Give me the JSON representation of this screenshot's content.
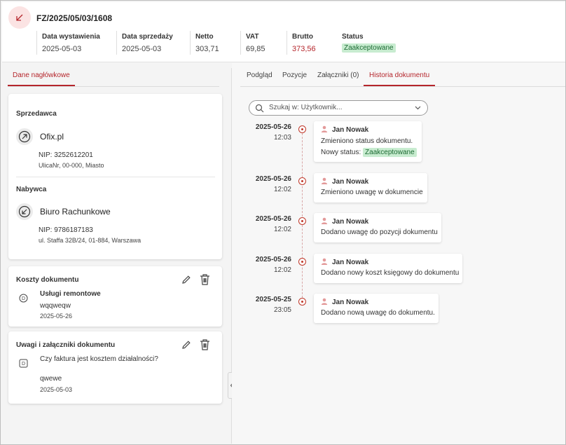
{
  "header": {
    "doc_number": "FZ/2025/05/03/1608",
    "fields": [
      {
        "label": "Data wystawienia",
        "value": "2025-05-03"
      },
      {
        "label": "Data sprzedaży",
        "value": "2025-05-03"
      },
      {
        "label": "Netto",
        "value": "303,71"
      },
      {
        "label": "VAT",
        "value": "69,85"
      },
      {
        "label": "Brutto",
        "value": "373,56"
      },
      {
        "label": "Status",
        "value": "Zaakceptowane"
      }
    ],
    "icon": "arrow-down-left-icon",
    "colors": {
      "accent": "#b5262c",
      "status_bg": "#c8ecd0",
      "status_fg": "#1d6b34"
    }
  },
  "left_tabs": [
    "Dane nagłówkowe"
  ],
  "parties": {
    "seller": {
      "title": "Sprzedawca",
      "name": "Ofix.pl",
      "nip": "NIP: 3252612201",
      "address": "UlicaNr, 00-000, Miasto",
      "icon": "arrow-up-right-circle-icon"
    },
    "buyer": {
      "title": "Nabywca",
      "name": "Biuro Rachunkowe",
      "nip": "NIP: 9786187183",
      "address": "ul. Staffa 32B/24, 01-884, Warszawa",
      "icon": "arrow-down-left-circle-icon"
    }
  },
  "costs": {
    "title": "Koszty dokumentu",
    "item_name": "Usługi remontowe",
    "item_desc": "wqqweqw",
    "item_date": "2025-05-26",
    "item_icon": "d-circle-icon"
  },
  "notes": {
    "title": "Uwagi i załączniki dokumentu",
    "question": "Czy faktura jest kosztem działalności?",
    "answer": "qwewe",
    "date": "2025-05-03",
    "item_icon": "d-square-icon"
  },
  "right_tabs": [
    "Podgląd",
    "Pozycje",
    "Załączniki (0)",
    "Historia dokumentu"
  ],
  "search": {
    "placeholder": "Szukaj w: Użytkownik..."
  },
  "history": [
    {
      "date": "2025-05-26",
      "time": "12:03",
      "user": "Jan Nowak",
      "text": "Zmieniono status dokumentu.",
      "status_prefix": "Nowy status:",
      "status": "Zaakceptowane"
    },
    {
      "date": "2025-05-26",
      "time": "12:02",
      "user": "Jan Nowak",
      "text": "Zmieniono uwagę w dokumencie"
    },
    {
      "date": "2025-05-26",
      "time": "12:02",
      "user": "Jan Nowak",
      "text": "Dodano uwagę do pozycji dokumentu"
    },
    {
      "date": "2025-05-26",
      "time": "12:02",
      "user": "Jan Nowak",
      "text": "Dodano nowy koszt księgowy do dokumentu"
    },
    {
      "date": "2025-05-25",
      "time": "23:05",
      "user": "Jan Nowak",
      "text": "Dodano nową uwagę do dokumentu."
    }
  ]
}
